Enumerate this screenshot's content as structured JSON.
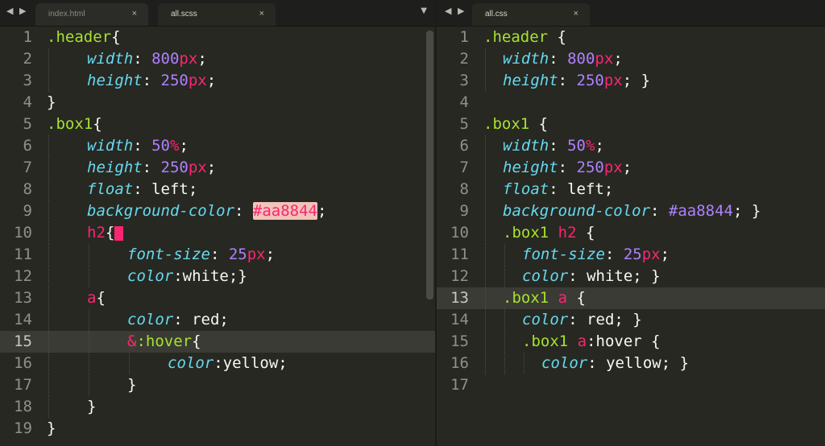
{
  "left": {
    "tabs": [
      {
        "label": "index.html",
        "active": false,
        "close": "×"
      },
      {
        "label": "all.scss",
        "active": true,
        "close": "×"
      }
    ],
    "nav_arrows": "◀ ▶",
    "dropdown": "▼",
    "highlighted_line": 15,
    "lines": [
      {
        "n": "1",
        "indent": 0,
        "tokens": [
          {
            "t": ".header",
            "c": "cls"
          },
          {
            "t": "{",
            "c": "p"
          }
        ]
      },
      {
        "n": "2",
        "indent": 1,
        "tokens": [
          {
            "t": "width",
            "c": "prop"
          },
          {
            "t": ": ",
            "c": "p"
          },
          {
            "t": "800",
            "c": "num"
          },
          {
            "t": "px",
            "c": "unit"
          },
          {
            "t": ";",
            "c": "p"
          }
        ]
      },
      {
        "n": "3",
        "indent": 1,
        "tokens": [
          {
            "t": "height",
            "c": "prop"
          },
          {
            "t": ": ",
            "c": "p"
          },
          {
            "t": "250",
            "c": "num"
          },
          {
            "t": "px",
            "c": "unit"
          },
          {
            "t": ";",
            "c": "p"
          }
        ]
      },
      {
        "n": "4",
        "indent": 0,
        "tokens": [
          {
            "t": "}",
            "c": "p"
          }
        ]
      },
      {
        "n": "5",
        "indent": 0,
        "tokens": [
          {
            "t": ".box1",
            "c": "cls"
          },
          {
            "t": "{",
            "c": "p"
          }
        ]
      },
      {
        "n": "6",
        "indent": 1,
        "tokens": [
          {
            "t": "width",
            "c": "prop"
          },
          {
            "t": ": ",
            "c": "p"
          },
          {
            "t": "50",
            "c": "num"
          },
          {
            "t": "%",
            "c": "unit"
          },
          {
            "t": ";",
            "c": "p"
          }
        ]
      },
      {
        "n": "7",
        "indent": 1,
        "tokens": [
          {
            "t": "height",
            "c": "prop"
          },
          {
            "t": ": ",
            "c": "p"
          },
          {
            "t": "250",
            "c": "num"
          },
          {
            "t": "px",
            "c": "unit"
          },
          {
            "t": ";",
            "c": "p"
          }
        ]
      },
      {
        "n": "8",
        "indent": 1,
        "tokens": [
          {
            "t": "float",
            "c": "prop"
          },
          {
            "t": ": left;",
            "c": "p"
          }
        ]
      },
      {
        "n": "9",
        "indent": 1,
        "tokens": [
          {
            "t": "background-color",
            "c": "prop"
          },
          {
            "t": ": ",
            "c": "p"
          },
          {
            "t": "#aa8844",
            "c": "hexbox"
          },
          {
            "t": ";",
            "c": "p"
          }
        ]
      },
      {
        "n": "10",
        "indent": 1,
        "tokens": [
          {
            "t": "h2",
            "c": "tag"
          },
          {
            "t": "{",
            "c": "p"
          },
          {
            "t": "",
            "c": "cursorbox"
          }
        ]
      },
      {
        "n": "11",
        "indent": 2,
        "tokens": [
          {
            "t": "font-size",
            "c": "prop"
          },
          {
            "t": ": ",
            "c": "p"
          },
          {
            "t": "25",
            "c": "num"
          },
          {
            "t": "px",
            "c": "unit"
          },
          {
            "t": ";",
            "c": "p"
          }
        ]
      },
      {
        "n": "12",
        "indent": 2,
        "tokens": [
          {
            "t": "color",
            "c": "prop"
          },
          {
            "t": ":white;}",
            "c": "p"
          }
        ]
      },
      {
        "n": "13",
        "indent": 1,
        "tokens": [
          {
            "t": "a",
            "c": "tag"
          },
          {
            "t": "{",
            "c": "p"
          }
        ]
      },
      {
        "n": "14",
        "indent": 2,
        "tokens": [
          {
            "t": "color",
            "c": "prop"
          },
          {
            "t": ": red;",
            "c": "p"
          }
        ]
      },
      {
        "n": "15",
        "indent": 2,
        "tokens": [
          {
            "t": "&",
            "c": "ampbox"
          },
          {
            "t": ":hover",
            "c": "ps"
          },
          {
            "t": "{",
            "c": "p"
          }
        ]
      },
      {
        "n": "16",
        "indent": 3,
        "tokens": [
          {
            "t": "color",
            "c": "prop"
          },
          {
            "t": ":yellow;",
            "c": "p"
          }
        ]
      },
      {
        "n": "17",
        "indent": 2,
        "tokens": [
          {
            "t": "}",
            "c": "p"
          }
        ]
      },
      {
        "n": "18",
        "indent": 1,
        "tokens": [
          {
            "t": "}",
            "c": "p"
          }
        ]
      },
      {
        "n": "19",
        "indent": 0,
        "tokens": [
          {
            "t": "}",
            "c": "p"
          }
        ]
      }
    ]
  },
  "right": {
    "tabs": [
      {
        "label": "all.css",
        "active": true,
        "close": "×"
      }
    ],
    "nav_arrows": "◀ ▶",
    "highlighted_line": 13,
    "lines": [
      {
        "n": "1",
        "indent": 0,
        "tokens": [
          {
            "t": ".header",
            "c": "cls"
          },
          {
            "t": " {",
            "c": "p"
          }
        ]
      },
      {
        "n": "2",
        "indent": 1,
        "tokens": [
          {
            "t": "width",
            "c": "prop"
          },
          {
            "t": ": ",
            "c": "p"
          },
          {
            "t": "800",
            "c": "num"
          },
          {
            "t": "px",
            "c": "unit"
          },
          {
            "t": ";",
            "c": "p"
          }
        ]
      },
      {
        "n": "3",
        "indent": 1,
        "tokens": [
          {
            "t": "height",
            "c": "prop"
          },
          {
            "t": ": ",
            "c": "p"
          },
          {
            "t": "250",
            "c": "num"
          },
          {
            "t": "px",
            "c": "unit"
          },
          {
            "t": "; }",
            "c": "p"
          }
        ]
      },
      {
        "n": "4",
        "indent": 0,
        "tokens": []
      },
      {
        "n": "5",
        "indent": 0,
        "tokens": [
          {
            "t": ".box1",
            "c": "cls"
          },
          {
            "t": " {",
            "c": "p"
          }
        ]
      },
      {
        "n": "6",
        "indent": 1,
        "tokens": [
          {
            "t": "width",
            "c": "prop"
          },
          {
            "t": ": ",
            "c": "p"
          },
          {
            "t": "50",
            "c": "num"
          },
          {
            "t": "%",
            "c": "unit"
          },
          {
            "t": ";",
            "c": "p"
          }
        ]
      },
      {
        "n": "7",
        "indent": 1,
        "tokens": [
          {
            "t": "height",
            "c": "prop"
          },
          {
            "t": ": ",
            "c": "p"
          },
          {
            "t": "250",
            "c": "num"
          },
          {
            "t": "px",
            "c": "unit"
          },
          {
            "t": ";",
            "c": "p"
          }
        ]
      },
      {
        "n": "8",
        "indent": 1,
        "tokens": [
          {
            "t": "float",
            "c": "prop"
          },
          {
            "t": ": left;",
            "c": "p"
          }
        ]
      },
      {
        "n": "9",
        "indent": 1,
        "tokens": [
          {
            "t": "background-color",
            "c": "prop"
          },
          {
            "t": ": ",
            "c": "p"
          },
          {
            "t": "#aa8844",
            "c": "num"
          },
          {
            "t": "; }",
            "c": "p"
          }
        ]
      },
      {
        "n": "10",
        "indent": 1,
        "tokens": [
          {
            "t": ".box1",
            "c": "cls"
          },
          {
            "t": " ",
            "c": "p"
          },
          {
            "t": "h2",
            "c": "tag"
          },
          {
            "t": " {",
            "c": "p"
          }
        ]
      },
      {
        "n": "11",
        "indent": 2,
        "tokens": [
          {
            "t": "font-size",
            "c": "prop"
          },
          {
            "t": ": ",
            "c": "p"
          },
          {
            "t": "25",
            "c": "num"
          },
          {
            "t": "px",
            "c": "unit"
          },
          {
            "t": ";",
            "c": "p"
          }
        ]
      },
      {
        "n": "12",
        "indent": 2,
        "tokens": [
          {
            "t": "color",
            "c": "prop"
          },
          {
            "t": ": white; }",
            "c": "p"
          }
        ]
      },
      {
        "n": "13",
        "indent": 1,
        "tokens": [
          {
            "t": ".box1",
            "c": "cls"
          },
          {
            "t": " ",
            "c": "p"
          },
          {
            "t": "a",
            "c": "tag"
          },
          {
            "t": " {",
            "c": "p"
          }
        ]
      },
      {
        "n": "14",
        "indent": 2,
        "tokens": [
          {
            "t": "color",
            "c": "prop"
          },
          {
            "t": ": red; }",
            "c": "p"
          }
        ]
      },
      {
        "n": "15",
        "indent": 2,
        "tokens": [
          {
            "t": ".box1",
            "c": "cls"
          },
          {
            "t": " ",
            "c": "p"
          },
          {
            "t": "a",
            "c": "tag"
          },
          {
            "t": ":hover {",
            "c": "p"
          }
        ]
      },
      {
        "n": "16",
        "indent": 3,
        "tokens": [
          {
            "t": "color",
            "c": "prop"
          },
          {
            "t": ": yellow; }",
            "c": "p"
          }
        ]
      },
      {
        "n": "17",
        "indent": 0,
        "tokens": []
      }
    ]
  }
}
